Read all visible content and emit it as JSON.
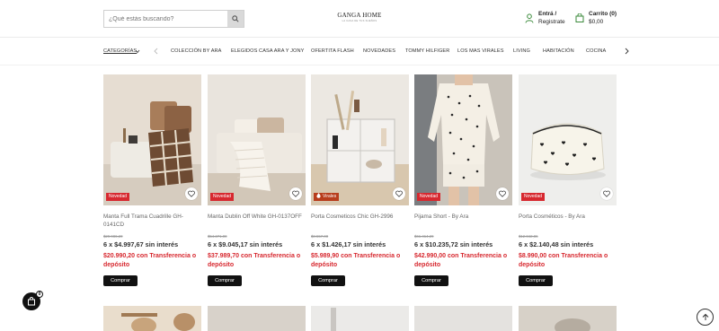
{
  "header": {
    "search_placeholder": "¿Qué estás buscando?",
    "logo_name": "GANGA HOME",
    "logo_tagline": "LA CASA DE TUS SUEÑOS",
    "account_title": "Entrá /",
    "account_sub": "Registrate",
    "cart_title": "Carrito",
    "cart_count": "(0)",
    "cart_total": "$0,00"
  },
  "nav": {
    "categories_label": "CATEGORÍAS",
    "items": [
      "COLECCIÓN BY ARA",
      "ELEGIDOS CASA ARA Y JONY",
      "OFERTITA FLASH",
      "NOVEDADES",
      "TOMMY HILFIGER",
      "LOS MAS VIRALES",
      "LIVING",
      "HABITACIÓN",
      "COCINA"
    ]
  },
  "products": [
    {
      "title": "Manta Full Trama Cuadrille GH-0141CD",
      "old_price": "$29.986,20",
      "installments": "6 x $4.997,67 sin interés",
      "transfer": "$20.990,20 con Transferencia o depósito",
      "badge": "Novedad",
      "buy_label": "Comprar"
    },
    {
      "title": "Manta Dublin Off White GH-0137OFF",
      "old_price": "$54.271,00",
      "installments": "6 x $9.045,17 sin interés",
      "transfer": "$37.989,70 con Transferencia o depósito",
      "badge": "Novedad",
      "buy_label": "Comprar"
    },
    {
      "title": "Porta Cosmeticos Chic GH-2996",
      "old_price": "$8.557,00",
      "installments": "6 x $1.426,17 sin interés",
      "transfer": "$5.989,90 con Transferencia o depósito",
      "badge": "Virales",
      "buy_label": "Comprar"
    },
    {
      "title": "Pijama Short - By Ara",
      "old_price": "$61.414,29",
      "installments": "6 x $10.235,72 sin interés",
      "transfer": "$42.990,00 con Transferencia o depósito",
      "badge": "Novedad",
      "buy_label": "Comprar"
    },
    {
      "title": "Porta Cosméticos - By Ara",
      "old_price": "$12.842,86",
      "installments": "6 x $2.140,48 sin interés",
      "transfer": "$8.990,00 con Transferencia o depósito",
      "badge": "Novedad",
      "buy_label": "Comprar"
    }
  ],
  "floating_cart": {
    "count": "0"
  },
  "colors": {
    "accent_red": "#d7282f",
    "button_black": "#111111"
  }
}
